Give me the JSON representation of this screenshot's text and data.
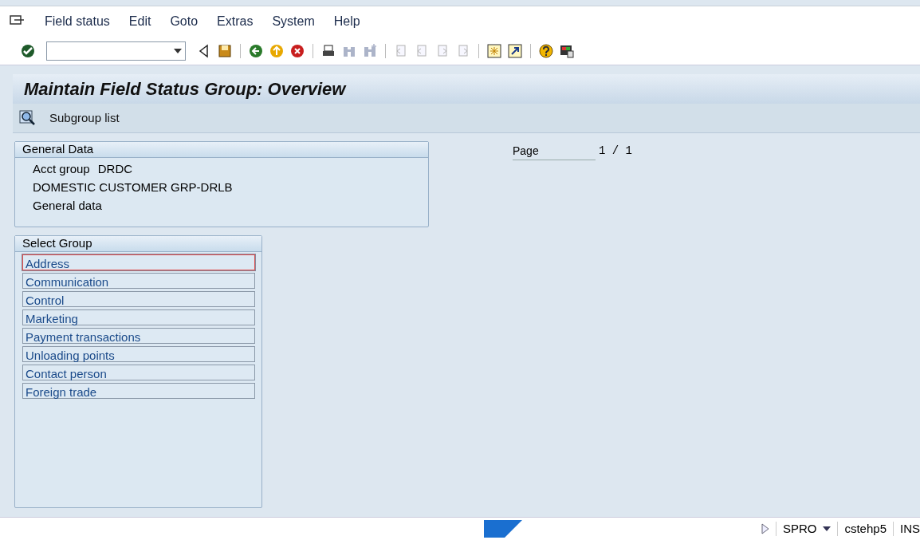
{
  "menu_bar": [
    "Field status",
    "Edit",
    "Goto",
    "Extras",
    "System",
    "Help"
  ],
  "toolbar": [
    {
      "kind": "enter",
      "disabled": false
    },
    {
      "kind": "command_field"
    },
    {
      "kind": "collapse",
      "disabled": false
    },
    {
      "kind": "save",
      "disabled": false
    },
    {
      "kind": "separator"
    },
    {
      "kind": "back",
      "disabled": false
    },
    {
      "kind": "exit",
      "disabled": false
    },
    {
      "kind": "cancel",
      "disabled": false
    },
    {
      "kind": "separator"
    },
    {
      "kind": "print",
      "disabled": false
    },
    {
      "kind": "find",
      "disabled": true
    },
    {
      "kind": "find_next",
      "disabled": true
    },
    {
      "kind": "separator"
    },
    {
      "kind": "first_page",
      "disabled": true
    },
    {
      "kind": "previous_page",
      "disabled": true
    },
    {
      "kind": "next_page",
      "disabled": true
    },
    {
      "kind": "last_page",
      "disabled": true
    },
    {
      "kind": "separator"
    },
    {
      "kind": "new_session",
      "disabled": false
    },
    {
      "kind": "shortcut",
      "disabled": false
    },
    {
      "kind": "separator"
    },
    {
      "kind": "help",
      "disabled": false
    },
    {
      "kind": "layout",
      "disabled": false
    }
  ],
  "title": "Maintain Field Status Group: Overview",
  "app_toolbar": [
    {
      "label": "Subgroup list"
    }
  ],
  "general_data": {
    "title": "General Data",
    "acct_group_label": "Acct group",
    "acct_group_value": "DRDC",
    "description": "DOMESTIC CUSTOMER GRP-DRLB",
    "line_3": "General data"
  },
  "page": {
    "label": "Page",
    "value": "1 / 1"
  },
  "select_group": {
    "title": "Select Group",
    "items": [
      {
        "label": "Address",
        "selected": true
      },
      {
        "label": "Communication",
        "selected": false
      },
      {
        "label": "Control",
        "selected": false
      },
      {
        "label": "Marketing",
        "selected": false
      },
      {
        "label": "Payment transactions",
        "selected": false
      },
      {
        "label": "Unloading points",
        "selected": false
      },
      {
        "label": "Contact person",
        "selected": false
      },
      {
        "label": "Foreign trade",
        "selected": false
      }
    ]
  },
  "status_bar": {
    "transaction": "SPRO",
    "server": "cstehp5",
    "mode": "INS"
  }
}
